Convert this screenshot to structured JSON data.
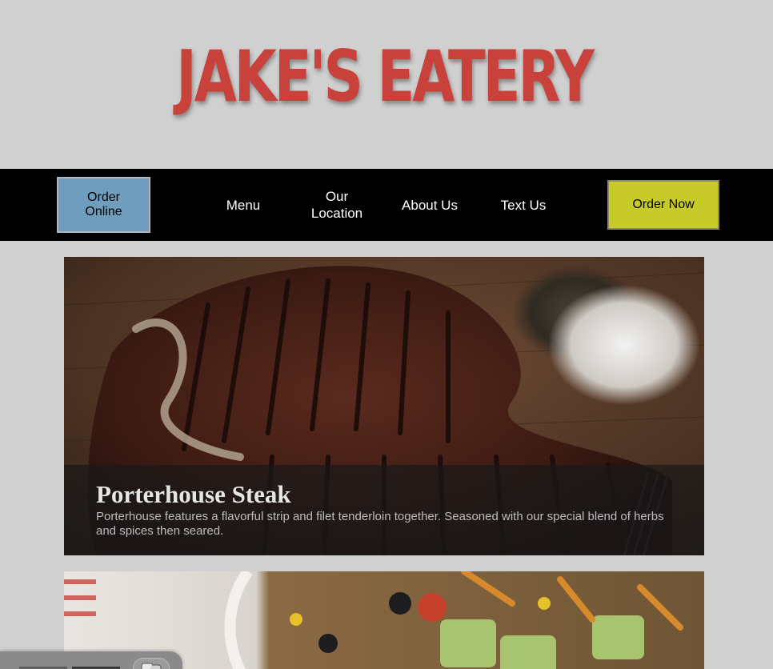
{
  "brand": {
    "name": "JAKE'S EATERY",
    "color": "#c8413a"
  },
  "nav": {
    "order_online_line1": "Order",
    "order_online_line2": "Online",
    "menu": "Menu",
    "location_line1": "Our",
    "location_line2": "Location",
    "about": "About Us",
    "text": "Text Us",
    "order_now": "Order Now",
    "colors": {
      "order_online_bg": "#6f9dbd",
      "order_now_bg": "#c7cb2a",
      "bar_bg": "#000000"
    }
  },
  "features": [
    {
      "title": "Porterhouse Steak",
      "description": "Porterhouse features a flavorful strip and filet tenderloin together. Seasoned with our special blend of herbs and spices then seared."
    }
  ],
  "widget": {
    "icon": "chat-bubbles-icon"
  }
}
